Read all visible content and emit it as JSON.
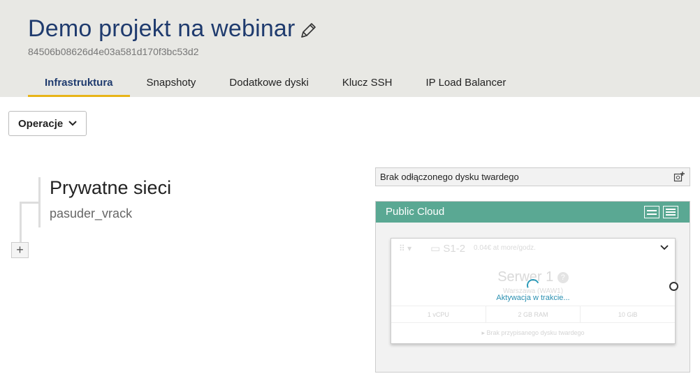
{
  "project": {
    "title": "Demo projekt na webinar",
    "id": "84506b08626d4e03a581d170f3bc53d2"
  },
  "tabs": [
    {
      "label": "Infrastruktura",
      "active": true
    },
    {
      "label": "Snapshoty",
      "active": false
    },
    {
      "label": "Dodatkowe dyski",
      "active": false
    },
    {
      "label": "Klucz SSH",
      "active": false
    },
    {
      "label": "IP Load Balancer",
      "active": false
    }
  ],
  "operations_label": "Operacje",
  "network": {
    "title": "Prywatne sieci",
    "name": "pasuder_vrack",
    "add_label": "+"
  },
  "disk_bar": {
    "label": "Brak odłączonego dysku twardego"
  },
  "cloud": {
    "title": "Public Cloud",
    "server": {
      "flavor": "S1-2",
      "price": "0.04€ at more/godz.",
      "name": "Serwer 1",
      "subtitle": "Warszawa (WAW1)",
      "status": "Aktywacja w trakcie...",
      "specs": [
        "1 vCPU",
        "2 GB RAM",
        "10 GiB"
      ],
      "no_disk": "Brak przypisanego dysku twardego"
    }
  },
  "colors": {
    "title_blue": "#1f3b6e",
    "tab_underline": "#e8b417",
    "cloud_header": "#5aa893",
    "status_text": "#2a8fb0"
  }
}
